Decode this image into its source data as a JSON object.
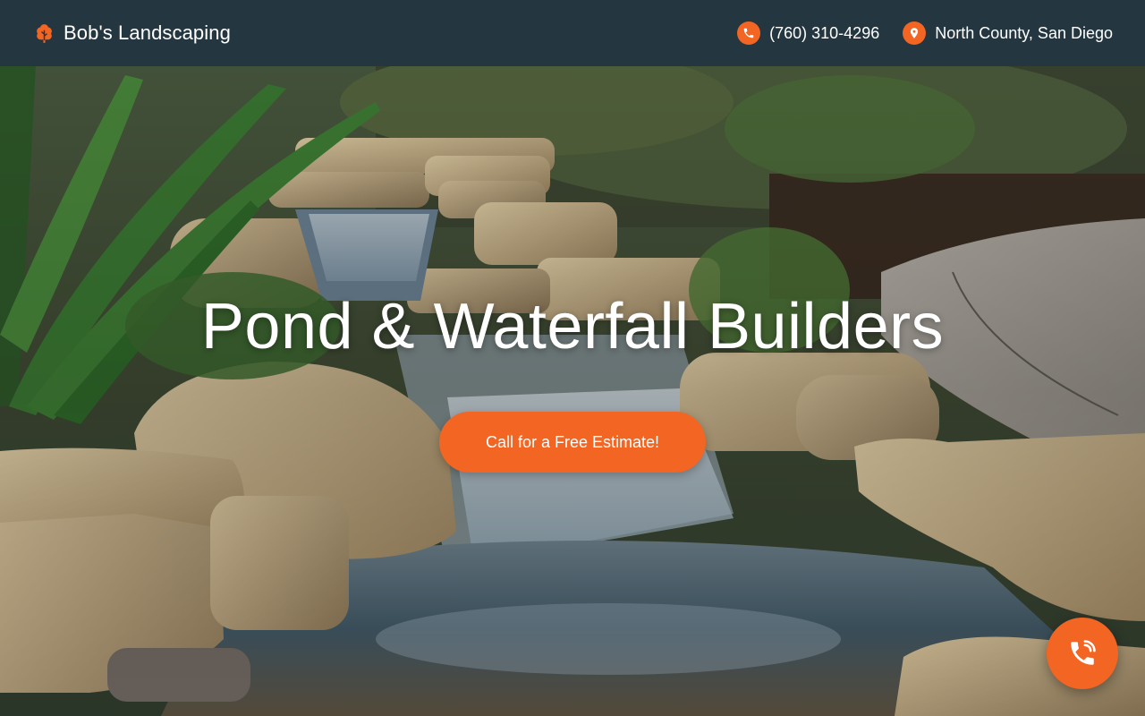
{
  "header": {
    "brand_name": "Bob's Landscaping",
    "brand_icon": "tree-icon",
    "phone": "(760) 310-4296",
    "phone_icon": "phone-icon",
    "location": "North County, San Diego",
    "location_icon": "map-pin-icon"
  },
  "hero": {
    "title": "Pond & Waterfall Builders",
    "cta_label": "Call for a Free Estimate!",
    "background": "garden-waterfall-photo"
  },
  "floating_call": {
    "icon": "phone-call-icon"
  },
  "colors": {
    "header_bg": "#243640",
    "accent": "#f26522",
    "text": "#ffffff"
  }
}
